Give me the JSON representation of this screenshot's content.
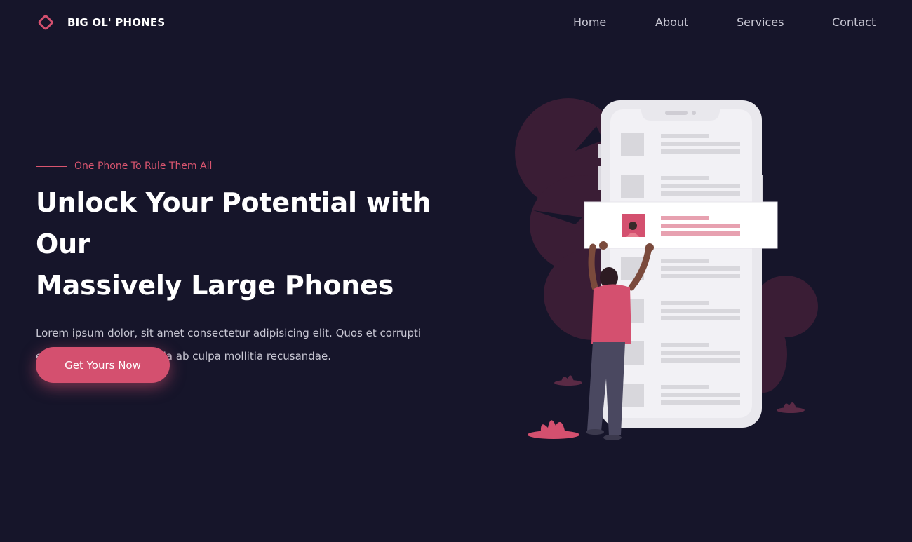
{
  "brand": {
    "name": "BIG OL' PHONES",
    "accent_color": "#d4506f",
    "logo_icon": "diamond-outline-icon"
  },
  "nav": {
    "items": [
      {
        "label": "Home"
      },
      {
        "label": "About"
      },
      {
        "label": "Services"
      },
      {
        "label": "Contact"
      }
    ]
  },
  "hero": {
    "eyebrow": "One Phone To Rule Them All",
    "headline_line1": "Unlock Your Potential with Our",
    "headline_line2": "Massively Large Phones",
    "body_line1": "Lorem ipsum dolor, sit amet consectetur adipisicing elit. Quos et corrupti",
    "body_line2": "eius modi, fugit odio nulla ab culpa mollitia recusandae.",
    "cta_label": "Get Yours Now"
  },
  "colors": {
    "background": "#16152a",
    "accent": "#d4506f",
    "text_muted": "#c9c8d4",
    "foliage": "#3a1d35"
  },
  "illustration": {
    "subject": "person reaching up to a highlighted list item on a giant phone"
  }
}
